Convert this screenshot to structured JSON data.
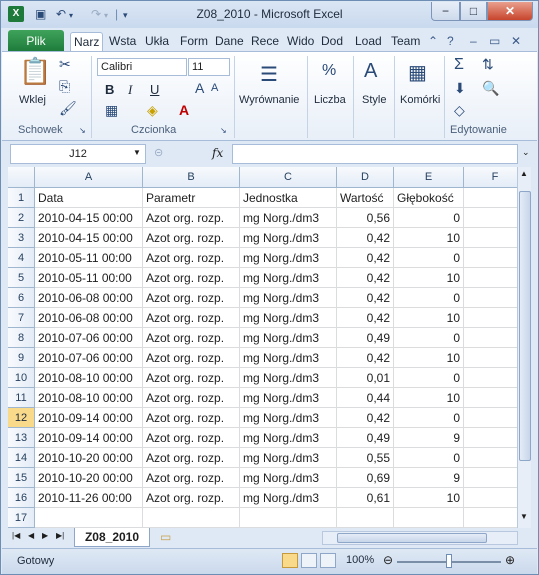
{
  "window": {
    "title": "Z08_2010  -  Microsoft Excel",
    "minimize": "−",
    "maximize": "□",
    "close": "✕"
  },
  "tabs": {
    "file": "Plik",
    "items": [
      "Narz",
      "Wsta",
      "Ukła",
      "Form",
      "Dane",
      "Rece",
      "Wido",
      "Dod",
      "Load",
      "Team"
    ]
  },
  "ribbon": {
    "paste_label": "Wklej",
    "groups": [
      "Schowek",
      "Czcionka",
      "Wyrównanie",
      "Liczba",
      "Style",
      "Komórki",
      "Edytowanie"
    ],
    "font_name": "Calibri",
    "font_size": "11",
    "bold": "B",
    "italic": "I",
    "underline": "U",
    "alignment_label": "Wyrównanie",
    "number_label": "Liczba",
    "number_symbol": "%",
    "styles_label": "Style",
    "cells_label": "Komórki",
    "sigma": "Σ"
  },
  "formula_bar": {
    "name_box": "J12",
    "fx": "fx",
    "value": ""
  },
  "sheet": {
    "columns": [
      "A",
      "B",
      "C",
      "D",
      "E",
      "F"
    ],
    "rows": [
      {
        "n": "1",
        "a": "Data",
        "b": "Parametr",
        "c": "Jednostka",
        "d": "Wartość",
        "e": "Głębokość"
      },
      {
        "n": "2",
        "a": "2010-04-15 00:00",
        "b": "Azot org. rozp.",
        "c": "mg Norg./dm3",
        "d": "0,56",
        "e": "0"
      },
      {
        "n": "3",
        "a": "2010-04-15 00:00",
        "b": "Azot org. rozp.",
        "c": "mg Norg./dm3",
        "d": "0,42",
        "e": "10"
      },
      {
        "n": "4",
        "a": "2010-05-11 00:00",
        "b": "Azot org. rozp.",
        "c": "mg Norg./dm3",
        "d": "0,42",
        "e": "0"
      },
      {
        "n": "5",
        "a": "2010-05-11 00:00",
        "b": "Azot org. rozp.",
        "c": "mg Norg./dm3",
        "d": "0,42",
        "e": "10"
      },
      {
        "n": "6",
        "a": "2010-06-08 00:00",
        "b": "Azot org. rozp.",
        "c": "mg Norg./dm3",
        "d": "0,42",
        "e": "0"
      },
      {
        "n": "7",
        "a": "2010-06-08 00:00",
        "b": "Azot org. rozp.",
        "c": "mg Norg./dm3",
        "d": "0,42",
        "e": "10"
      },
      {
        "n": "8",
        "a": "2010-07-06 00:00",
        "b": "Azot org. rozp.",
        "c": "mg Norg./dm3",
        "d": "0,49",
        "e": "0"
      },
      {
        "n": "9",
        "a": "2010-07-06 00:00",
        "b": "Azot org. rozp.",
        "c": "mg Norg./dm3",
        "d": "0,42",
        "e": "10"
      },
      {
        "n": "10",
        "a": "2010-08-10 00:00",
        "b": "Azot org. rozp.",
        "c": "mg Norg./dm3",
        "d": "0,01",
        "e": "0"
      },
      {
        "n": "11",
        "a": "2010-08-10 00:00",
        "b": "Azot org. rozp.",
        "c": "mg Norg./dm3",
        "d": "0,44",
        "e": "10"
      },
      {
        "n": "12",
        "a": "2010-09-14 00:00",
        "b": "Azot org. rozp.",
        "c": "mg Norg./dm3",
        "d": "0,42",
        "e": "0"
      },
      {
        "n": "13",
        "a": "2010-09-14 00:00",
        "b": "Azot org. rozp.",
        "c": "mg Norg./dm3",
        "d": "0,49",
        "e": "9"
      },
      {
        "n": "14",
        "a": "2010-10-20 00:00",
        "b": "Azot org. rozp.",
        "c": "mg Norg./dm3",
        "d": "0,55",
        "e": "0"
      },
      {
        "n": "15",
        "a": "2010-10-20 00:00",
        "b": "Azot org. rozp.",
        "c": "mg Norg./dm3",
        "d": "0,69",
        "e": "9"
      },
      {
        "n": "16",
        "a": "2010-11-26 00:00",
        "b": "Azot org. rozp.",
        "c": "mg Norg./dm3",
        "d": "0,61",
        "e": "10"
      },
      {
        "n": "17",
        "a": "",
        "b": "",
        "c": "",
        "d": "",
        "e": ""
      }
    ],
    "selected_row": "12"
  },
  "sheet_tabs": {
    "active": "Z08_2010"
  },
  "status": {
    "ready": "Gotowy",
    "zoom": "100%"
  },
  "colors": {
    "accent": "#1d7a3a",
    "selection": "#f9d98a"
  }
}
